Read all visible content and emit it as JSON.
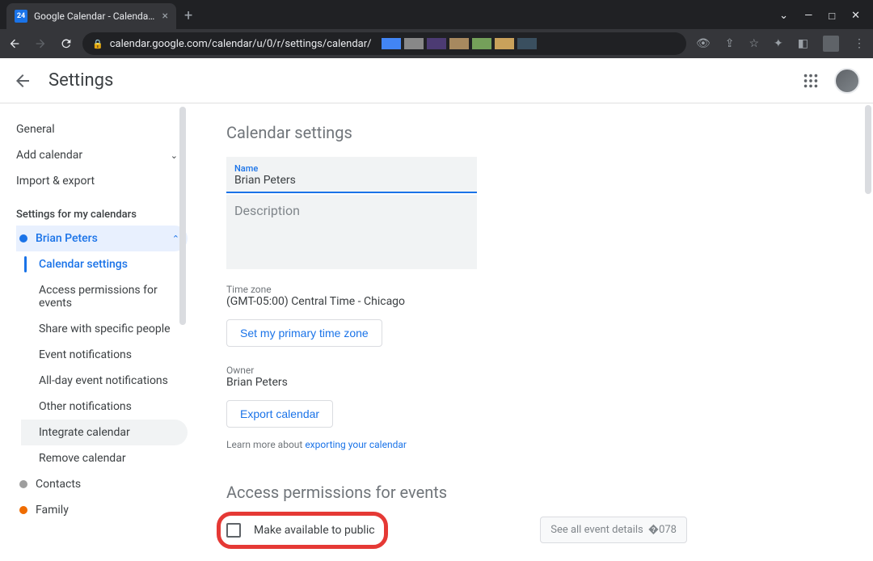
{
  "browser": {
    "tab_title": "Google Calendar - Calendar setti",
    "url": "calendar.google.com/calendar/u/0/r/settings/calendar/"
  },
  "header": {
    "title": "Settings"
  },
  "sidebar": {
    "general": "General",
    "add_calendar": "Add calendar",
    "import_export": "Import & export",
    "section_title": "Settings for my calendars",
    "calendars": [
      {
        "name": "Brian Peters",
        "color": "#1a73e8",
        "active": true
      },
      {
        "name": "Contacts",
        "color": "#9e9e9e",
        "active": false
      },
      {
        "name": "Family",
        "color": "#ef6c00",
        "active": false
      }
    ],
    "sub_items": {
      "calendar_settings": "Calendar settings",
      "access_permissions": "Access permissions for events",
      "share_specific": "Share with specific people",
      "event_notifications": "Event notifications",
      "allday_notifications": "All-day event notifications",
      "other_notifications": "Other notifications",
      "integrate_calendar": "Integrate calendar",
      "remove_calendar": "Remove calendar"
    }
  },
  "main": {
    "section1_title": "Calendar settings",
    "name_label": "Name",
    "name_value": "Brian Peters",
    "description_label": "Description",
    "timezone_label": "Time zone",
    "timezone_value": "(GMT-05:00) Central Time - Chicago",
    "set_primary_btn": "Set my primary time zone",
    "owner_label": "Owner",
    "owner_value": "Brian Peters",
    "export_btn": "Export calendar",
    "learn_more_prefix": "Learn more about ",
    "learn_more_link": "exporting your calendar",
    "section2_title": "Access permissions for events",
    "make_public_label": "Make available to public",
    "see_all_details": "See all event details"
  }
}
